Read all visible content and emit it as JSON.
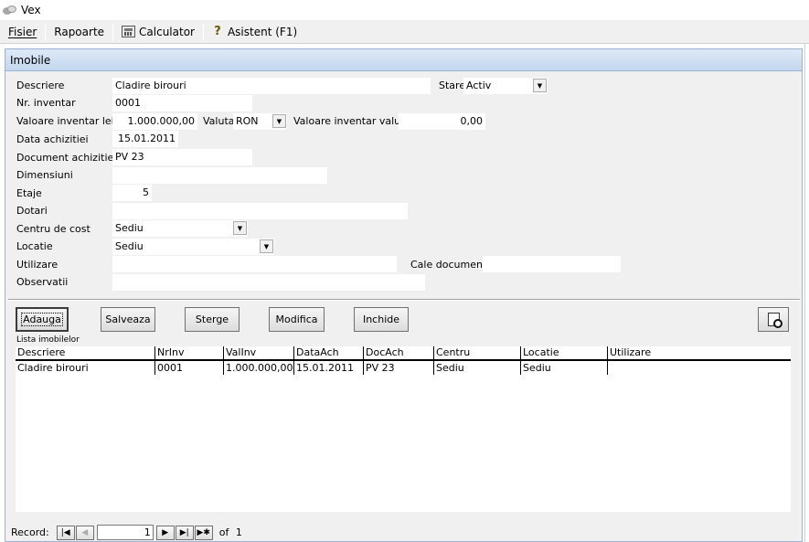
{
  "app": {
    "title": "Vex"
  },
  "menu": {
    "file": "Fisier",
    "reports": "Rapoarte",
    "calculator": "Calculator",
    "assistant": "Asistent (F1)"
  },
  "form": {
    "title": "Imobile",
    "descriere": {
      "label": "Descriere",
      "value": "Cladire birouri"
    },
    "stare": {
      "label": "Stare",
      "value": "Activ"
    },
    "nr_inventar": {
      "label": "Nr. inventar",
      "value": "0001"
    },
    "valoare_lei": {
      "label": "Valoare inventar lei",
      "value": "1.000.000,00"
    },
    "valuta": {
      "label": "Valuta",
      "value": "RON"
    },
    "valoare_valuta": {
      "label": "Valoare inventar valuta",
      "value": "0,00"
    },
    "data_achizitiei": {
      "label": "Data achizitiei",
      "value": "15.01.2011"
    },
    "document_achizitie": {
      "label": "Document achizitie",
      "value": "PV 23"
    },
    "dimensiuni": {
      "label": "Dimensiuni",
      "value": ""
    },
    "etaje": {
      "label": "Etaje",
      "value": "5"
    },
    "dotari": {
      "label": "Dotari",
      "value": ""
    },
    "centru_cost": {
      "label": "Centru de cost",
      "value": "Sediu"
    },
    "locatie": {
      "label": "Locatie",
      "value": "Sediu"
    },
    "utilizare": {
      "label": "Utilizare",
      "value": ""
    },
    "cale_documente": {
      "label": "Cale documente",
      "value": ""
    },
    "observatii": {
      "label": "Observatii",
      "value": ""
    }
  },
  "buttons": {
    "add": "Adauga",
    "save": "Salveaza",
    "delete": "Sterge",
    "modify": "Modifica",
    "close": "Inchide"
  },
  "list": {
    "caption": "Lista imobilelor",
    "columns": [
      "Descriere",
      "NrInv",
      "ValInv",
      "DataAch",
      "DocAch",
      "Centru",
      "Locatie",
      "Utilizare"
    ],
    "rows": [
      [
        "Cladire birouri",
        "0001",
        "1.000.000,00",
        "15.01.2011",
        "PV 23",
        "Sediu",
        "Sediu",
        ""
      ]
    ]
  },
  "navigation": {
    "record_label": "Record:",
    "current": "1",
    "of_label": "of",
    "total": "1"
  }
}
